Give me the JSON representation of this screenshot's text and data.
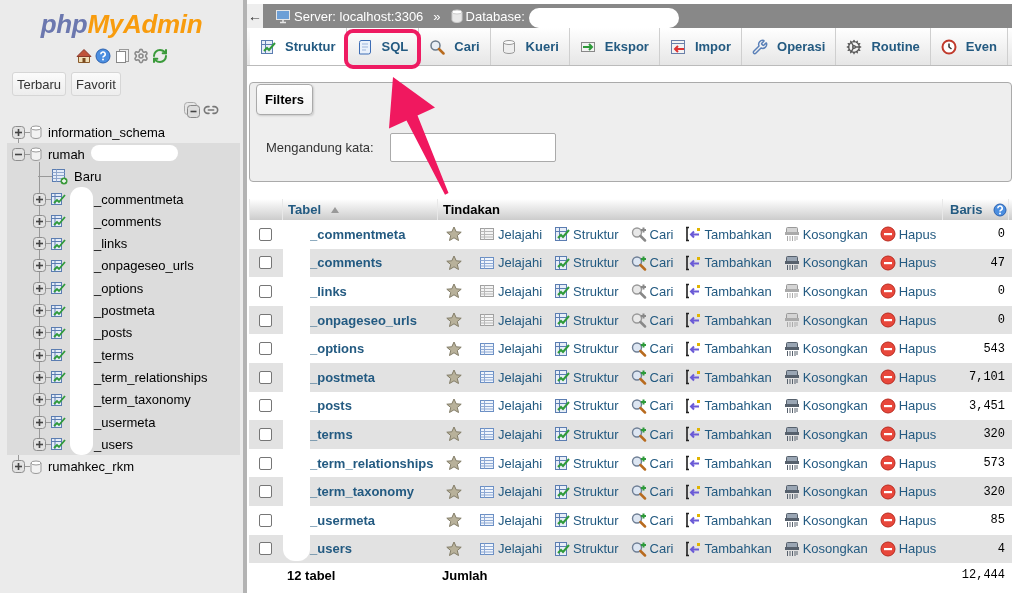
{
  "sidebar": {
    "logo": {
      "parts": [
        "php",
        "MyAdmin"
      ]
    },
    "buttons": [
      "Terbaru",
      "Favorit"
    ],
    "tree": [
      {
        "kind": "database",
        "name": "information_schema",
        "expanded": false,
        "selected": false
      },
      {
        "kind": "database",
        "name": "rumah",
        "expanded": true,
        "selected": true,
        "children": [
          {
            "kind": "new",
            "name": "Baru",
            "selected": false
          },
          {
            "kind": "table",
            "name": "_commentmeta",
            "expanded": false,
            "selected": false
          },
          {
            "kind": "table",
            "name": "_comments",
            "expanded": false,
            "selected": false
          },
          {
            "kind": "table",
            "name": "_links",
            "expanded": false,
            "selected": false
          },
          {
            "kind": "table",
            "name": "_onpageseo_urls",
            "expanded": false,
            "selected": false
          },
          {
            "kind": "table",
            "name": "_options",
            "expanded": false,
            "selected": false
          },
          {
            "kind": "table",
            "name": "_postmeta",
            "expanded": false,
            "selected": false
          },
          {
            "kind": "table",
            "name": "_posts",
            "expanded": false,
            "selected": false
          },
          {
            "kind": "table",
            "name": "_terms",
            "expanded": false,
            "selected": false
          },
          {
            "kind": "table",
            "name": "_term_relationships",
            "expanded": false,
            "selected": false
          },
          {
            "kind": "table",
            "name": "_term_taxonomy",
            "expanded": false,
            "selected": false
          },
          {
            "kind": "table",
            "name": "_usermeta",
            "expanded": false,
            "selected": false
          },
          {
            "kind": "table",
            "name": "_users",
            "expanded": false,
            "selected": false
          }
        ]
      },
      {
        "kind": "database",
        "name": "rumahkec_rkm",
        "expanded": false,
        "selected": false
      }
    ]
  },
  "breadcrumb": {
    "back": "←",
    "server": "Server: localhost:3306",
    "separator": "»",
    "database": "Database:"
  },
  "tabs": [
    {
      "kind": "structure",
      "label": "Struktur",
      "selected": true,
      "highlighted": false
    },
    {
      "kind": "sql",
      "label": "SQL",
      "selected": false,
      "highlighted": true
    },
    {
      "kind": "search",
      "label": "Cari",
      "selected": false,
      "highlighted": false
    },
    {
      "kind": "query",
      "label": "Kueri",
      "selected": false,
      "highlighted": false
    },
    {
      "kind": "export",
      "label": "Ekspor",
      "selected": false,
      "highlighted": false
    },
    {
      "kind": "import",
      "label": "Impor",
      "selected": false,
      "highlighted": false
    },
    {
      "kind": "operations",
      "label": "Operasi",
      "selected": false,
      "highlighted": false
    },
    {
      "kind": "routines",
      "label": "Routine",
      "selected": false,
      "highlighted": false
    },
    {
      "kind": "events",
      "label": "Even",
      "selected": false,
      "highlighted": false
    }
  ],
  "filters": {
    "legend": "Filters",
    "label": "Mengandung kata:"
  },
  "table": {
    "columns": [
      {
        "label": "Tabel",
        "kind": "link",
        "sorted": true
      },
      {
        "label": "Tindakan",
        "kind": "plain"
      },
      {
        "label": "Baris",
        "kind": "link",
        "help": true
      }
    ],
    "rows": [
      {
        "checked": false,
        "name": "_commentmeta",
        "favorite": false,
        "empty": true,
        "actions": [
          {
            "kind": "browse",
            "label": "Jelajahi"
          },
          {
            "kind": "structure",
            "label": "Struktur"
          },
          {
            "kind": "search",
            "label": "Cari"
          },
          {
            "kind": "insert",
            "label": "Tambahkan"
          },
          {
            "kind": "empty",
            "label": "Kosongkan"
          },
          {
            "kind": "drop",
            "label": "Hapus"
          }
        ],
        "count": "0"
      },
      {
        "checked": false,
        "name": "_comments",
        "favorite": false,
        "empty": false,
        "actions": [
          {
            "kind": "browse",
            "label": "Jelajahi"
          },
          {
            "kind": "structure",
            "label": "Struktur"
          },
          {
            "kind": "search",
            "label": "Cari"
          },
          {
            "kind": "insert",
            "label": "Tambahkan"
          },
          {
            "kind": "empty",
            "label": "Kosongkan"
          },
          {
            "kind": "drop",
            "label": "Hapus"
          }
        ],
        "count": "47"
      },
      {
        "checked": false,
        "name": "_links",
        "favorite": false,
        "empty": true,
        "actions": [
          {
            "kind": "browse",
            "label": "Jelajahi"
          },
          {
            "kind": "structure",
            "label": "Struktur"
          },
          {
            "kind": "search",
            "label": "Cari"
          },
          {
            "kind": "insert",
            "label": "Tambahkan"
          },
          {
            "kind": "empty",
            "label": "Kosongkan"
          },
          {
            "kind": "drop",
            "label": "Hapus"
          }
        ],
        "count": "0"
      },
      {
        "checked": false,
        "name": "_onpageseo_urls",
        "favorite": false,
        "empty": true,
        "actions": [
          {
            "kind": "browse",
            "label": "Jelajahi"
          },
          {
            "kind": "structure",
            "label": "Struktur"
          },
          {
            "kind": "search",
            "label": "Cari"
          },
          {
            "kind": "insert",
            "label": "Tambahkan"
          },
          {
            "kind": "empty",
            "label": "Kosongkan"
          },
          {
            "kind": "drop",
            "label": "Hapus"
          }
        ],
        "count": "0"
      },
      {
        "checked": false,
        "name": "_options",
        "favorite": false,
        "empty": false,
        "actions": [
          {
            "kind": "browse",
            "label": "Jelajahi"
          },
          {
            "kind": "structure",
            "label": "Struktur"
          },
          {
            "kind": "search",
            "label": "Cari"
          },
          {
            "kind": "insert",
            "label": "Tambahkan"
          },
          {
            "kind": "empty",
            "label": "Kosongkan"
          },
          {
            "kind": "drop",
            "label": "Hapus"
          }
        ],
        "count": "543"
      },
      {
        "checked": false,
        "name": "_postmeta",
        "favorite": false,
        "empty": false,
        "actions": [
          {
            "kind": "browse",
            "label": "Jelajahi"
          },
          {
            "kind": "structure",
            "label": "Struktur"
          },
          {
            "kind": "search",
            "label": "Cari"
          },
          {
            "kind": "insert",
            "label": "Tambahkan"
          },
          {
            "kind": "empty",
            "label": "Kosongkan"
          },
          {
            "kind": "drop",
            "label": "Hapus"
          }
        ],
        "count": "7,101"
      },
      {
        "checked": false,
        "name": "_posts",
        "favorite": false,
        "empty": false,
        "actions": [
          {
            "kind": "browse",
            "label": "Jelajahi"
          },
          {
            "kind": "structure",
            "label": "Struktur"
          },
          {
            "kind": "search",
            "label": "Cari"
          },
          {
            "kind": "insert",
            "label": "Tambahkan"
          },
          {
            "kind": "empty",
            "label": "Kosongkan"
          },
          {
            "kind": "drop",
            "label": "Hapus"
          }
        ],
        "count": "3,451"
      },
      {
        "checked": false,
        "name": "_terms",
        "favorite": false,
        "empty": false,
        "actions": [
          {
            "kind": "browse",
            "label": "Jelajahi"
          },
          {
            "kind": "structure",
            "label": "Struktur"
          },
          {
            "kind": "search",
            "label": "Cari"
          },
          {
            "kind": "insert",
            "label": "Tambahkan"
          },
          {
            "kind": "empty",
            "label": "Kosongkan"
          },
          {
            "kind": "drop",
            "label": "Hapus"
          }
        ],
        "count": "320"
      },
      {
        "checked": false,
        "name": "_term_relationships",
        "favorite": false,
        "empty": false,
        "actions": [
          {
            "kind": "browse",
            "label": "Jelajahi"
          },
          {
            "kind": "structure",
            "label": "Struktur"
          },
          {
            "kind": "search",
            "label": "Cari"
          },
          {
            "kind": "insert",
            "label": "Tambahkan"
          },
          {
            "kind": "empty",
            "label": "Kosongkan"
          },
          {
            "kind": "drop",
            "label": "Hapus"
          }
        ],
        "count": "573"
      },
      {
        "checked": false,
        "name": "_term_taxonomy",
        "favorite": false,
        "empty": false,
        "actions": [
          {
            "kind": "browse",
            "label": "Jelajahi"
          },
          {
            "kind": "structure",
            "label": "Struktur"
          },
          {
            "kind": "search",
            "label": "Cari"
          },
          {
            "kind": "insert",
            "label": "Tambahkan"
          },
          {
            "kind": "empty",
            "label": "Kosongkan"
          },
          {
            "kind": "drop",
            "label": "Hapus"
          }
        ],
        "count": "320"
      },
      {
        "checked": false,
        "name": "_usermeta",
        "favorite": false,
        "empty": false,
        "actions": [
          {
            "kind": "browse",
            "label": "Jelajahi"
          },
          {
            "kind": "structure",
            "label": "Struktur"
          },
          {
            "kind": "search",
            "label": "Cari"
          },
          {
            "kind": "insert",
            "label": "Tambahkan"
          },
          {
            "kind": "empty",
            "label": "Kosongkan"
          },
          {
            "kind": "drop",
            "label": "Hapus"
          }
        ],
        "count": "85"
      },
      {
        "checked": false,
        "name": "_users",
        "favorite": false,
        "empty": false,
        "actions": [
          {
            "kind": "browse",
            "label": "Jelajahi"
          },
          {
            "kind": "structure",
            "label": "Struktur"
          },
          {
            "kind": "search",
            "label": "Cari"
          },
          {
            "kind": "insert",
            "label": "Tambahkan"
          },
          {
            "kind": "empty",
            "label": "Kosongkan"
          },
          {
            "kind": "drop",
            "label": "Hapus"
          }
        ],
        "count": "4"
      }
    ],
    "footer": {
      "count": "12 tabel",
      "label": "Jumlah",
      "total": "12,444"
    }
  }
}
